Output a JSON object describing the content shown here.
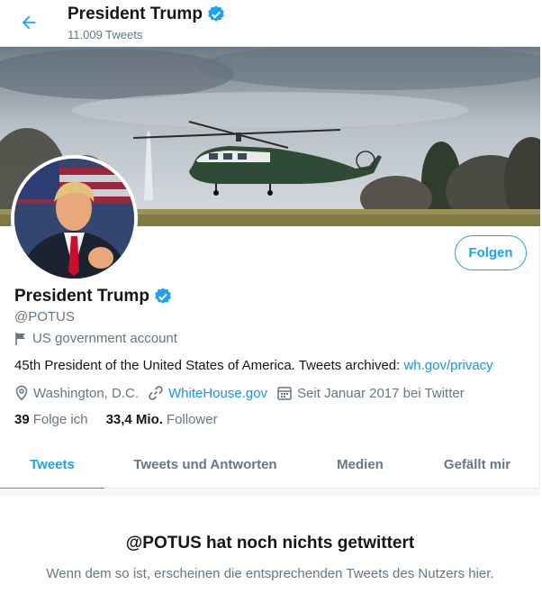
{
  "header": {
    "name": "President Trump",
    "tweet_count": "11.009 Tweets"
  },
  "profile": {
    "name": "President Trump",
    "handle": "@POTUS",
    "label": "US government account",
    "bio_text": "45th President of the United States of America. Tweets archived: ",
    "bio_link": "wh.gov/privacy",
    "location": "Washington, D.C.",
    "website": "WhiteHouse.gov",
    "joined": "Seit Januar 2017 bei Twitter",
    "following_count": "39",
    "following_label": "Folge ich",
    "followers_count": "33,4 Mio.",
    "followers_label": "Follower"
  },
  "follow_button": {
    "label": "Folgen"
  },
  "tabs": [
    {
      "label": "Tweets",
      "active": true
    },
    {
      "label": "Tweets und Antworten",
      "active": false
    },
    {
      "label": "Medien",
      "active": false
    },
    {
      "label": "Gefällt mir",
      "active": false
    }
  ],
  "empty_state": {
    "title": "@POTUS hat noch nichts getwittert",
    "subtitle": "Wenn dem so ist, erscheinen die entsprechenden Tweets des Nutzers hier."
  },
  "colors": {
    "accent": "#1da1f2",
    "link": "#1b95e0",
    "text_primary": "#14171a",
    "text_secondary": "#657786",
    "border": "#e6ecf0"
  },
  "icons": {
    "back": "arrow-left-icon",
    "verified": "verified-badge-icon",
    "label": "flag-icon",
    "location": "location-pin-icon",
    "website": "link-icon",
    "joined": "calendar-icon"
  }
}
